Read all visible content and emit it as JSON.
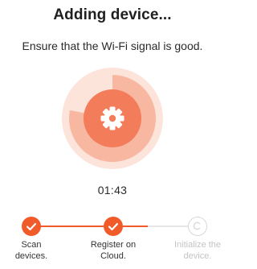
{
  "title": "Adding device...",
  "subtitle": "Ensure that the Wi-Fi signal is good.",
  "timer": "01:43",
  "progress": 0.78,
  "icon": "gear-icon",
  "colors": {
    "accent": "#f15a29",
    "ring_light": "#fde4db",
    "ring_mid": "#f8b7a1",
    "ring_core": "#f37c5a",
    "pending": "#d8d8d8"
  },
  "steps": [
    {
      "label_line1": "Scan",
      "label_line2": "devices.",
      "status": "done"
    },
    {
      "label_line1": "Register on",
      "label_line2": "Cloud.",
      "status": "done"
    },
    {
      "label_line1": "Initialize the",
      "label_line2": "device.",
      "status": "pending"
    }
  ]
}
